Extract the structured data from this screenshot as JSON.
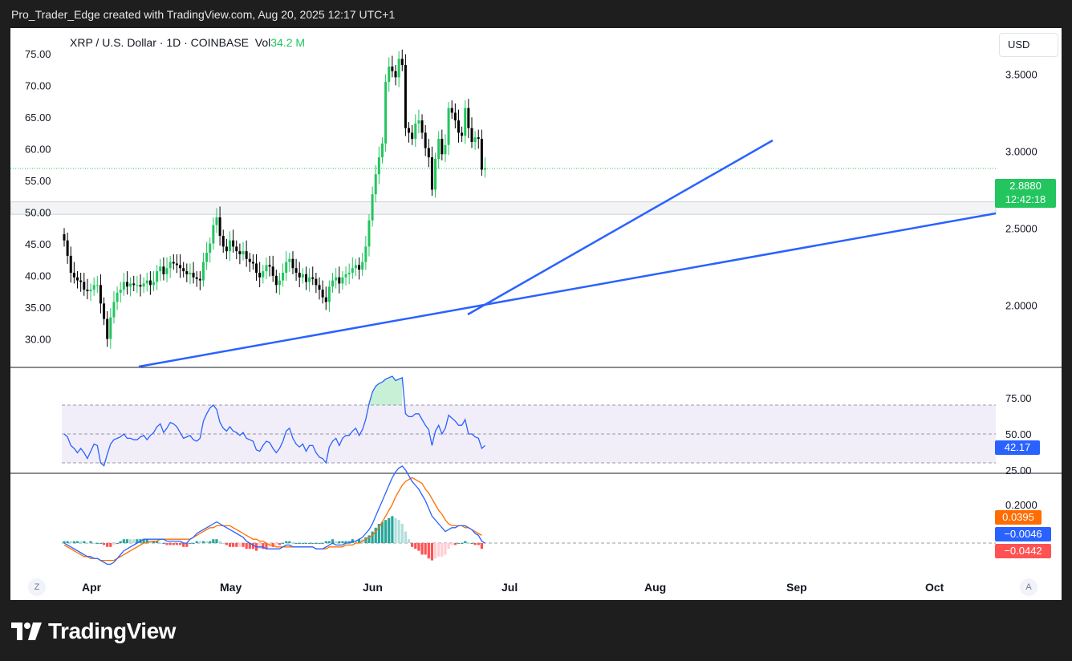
{
  "caption": "Pro_Trader_Edge created with TradingView.com, Aug 20, 2025 12:17 UTC+1",
  "legend": {
    "symbol": "XRP / U.S. Dollar · 1D · COINBASE",
    "vol_label": "Vol",
    "vol_value": "34.2 M"
  },
  "currency_label": "USD",
  "brand": "TradingView",
  "buttons": {
    "zoom": "Z",
    "auto": "A"
  },
  "colors": {
    "up": "#22c55e",
    "down": "#000000",
    "trendline": "#2962ff",
    "macd": "#2962ff",
    "signal": "#ff6d00",
    "rsi": "#2962ff",
    "rsi_band": "#7e57c2"
  },
  "price_tag": {
    "price": "2.8880",
    "countdown": "12:42:18"
  },
  "rsi_tag": "42.17",
  "macd_tags": {
    "signal": "0.0395",
    "macd": "−0.0046",
    "histogram": "−0.0442"
  },
  "chart_data": [
    {
      "type": "candlestick",
      "title": "XRP / U.S. Dollar · 1D · COINBASE",
      "x_ticks": [
        "Apr",
        "May",
        "Jun",
        "Jul",
        "Aug",
        "Sep",
        "Oct"
      ],
      "left_axis_ticks": [
        "75.00",
        "70.00",
        "65.00",
        "60.00",
        "55.00",
        "50.00",
        "45.00",
        "40.00",
        "35.00",
        "30.00"
      ],
      "right_axis_ticks": [
        "3.5000",
        "3.0000",
        "2.5000",
        "2.0000"
      ],
      "ylim": [
        1.6,
        3.8
      ],
      "last_price": 2.888,
      "close": [
        2.42,
        2.32,
        2.21,
        2.18,
        2.16,
        2.15,
        2.1,
        2.09,
        2.1,
        2.13,
        2.13,
        2.01,
        1.91,
        1.78,
        1.92,
        2.02,
        2.08,
        2.1,
        2.15,
        2.12,
        2.14,
        2.13,
        2.13,
        2.12,
        2.14,
        2.16,
        2.13,
        2.15,
        2.22,
        2.25,
        2.2,
        2.24,
        2.28,
        2.27,
        2.26,
        2.24,
        2.22,
        2.2,
        2.21,
        2.18,
        2.17,
        2.16,
        2.28,
        2.34,
        2.4,
        2.52,
        2.57,
        2.45,
        2.38,
        2.35,
        2.42,
        2.38,
        2.35,
        2.33,
        2.35,
        2.3,
        2.28,
        2.27,
        2.21,
        2.18,
        2.22,
        2.26,
        2.25,
        2.19,
        2.13,
        2.16,
        2.21,
        2.28,
        2.3,
        2.24,
        2.21,
        2.18,
        2.2,
        2.15,
        2.18,
        2.17,
        2.13,
        2.1,
        2.05,
        2.02,
        2.12,
        2.16,
        2.18,
        2.14,
        2.18,
        2.2,
        2.21,
        2.24,
        2.26,
        2.23,
        2.28,
        2.38,
        2.55,
        2.72,
        2.85,
        2.96,
        3.05,
        3.45,
        3.55,
        3.52,
        3.48,
        3.6,
        3.56,
        3.15,
        3.12,
        3.08,
        3.18,
        3.2,
        3.12,
        3.02,
        2.96,
        2.75,
        2.95,
        3.08,
        2.98,
        3.04,
        3.28,
        3.25,
        3.2,
        3.12,
        3.1,
        3.28,
        3.15,
        3.06,
        3.09,
        3.08,
        2.88,
        2.89
      ],
      "rsi": {
        "levels": [
          70,
          50,
          30
        ],
        "ticks": [
          "75.00",
          "50.00",
          "25.00"
        ],
        "last": 42.17,
        "values": [
          50,
          48,
          42,
          40,
          37,
          40,
          37,
          33,
          38,
          43,
          42,
          30,
          28,
          36,
          43,
          46,
          47,
          48,
          50,
          47,
          47,
          46,
          46,
          48,
          49,
          46,
          49,
          51,
          55,
          57,
          51,
          54,
          58,
          57,
          55,
          51,
          47,
          48,
          49,
          46,
          45,
          47,
          59,
          64,
          68,
          70,
          67,
          58,
          54,
          52,
          55,
          52,
          51,
          49,
          51,
          47,
          46,
          45,
          39,
          38,
          42,
          45,
          44,
          40,
          37,
          40,
          45,
          52,
          54,
          47,
          43,
          41,
          43,
          38,
          42,
          42,
          37,
          34,
          33,
          30,
          41,
          45,
          47,
          42,
          47,
          49,
          49,
          52,
          54,
          49,
          53,
          60,
          71,
          79,
          83,
          85,
          86,
          88,
          89,
          90,
          87,
          88,
          89,
          64,
          62,
          62,
          64,
          64,
          60,
          56,
          53,
          42,
          52,
          56,
          50,
          54,
          63,
          61,
          59,
          56,
          56,
          60,
          50,
          50,
          48,
          47,
          40,
          42
        ]
      },
      "macd": {
        "ticks": [
          "0.2000"
        ],
        "last": {
          "signal": 0.0395,
          "macd": -0.0046,
          "histogram": -0.0442
        },
        "macd_values": [
          0.0,
          -0.01,
          -0.02,
          -0.03,
          -0.04,
          -0.05,
          -0.06,
          -0.07,
          -0.07,
          -0.08,
          -0.08,
          -0.09,
          -0.1,
          -0.11,
          -0.11,
          -0.1,
          -0.08,
          -0.06,
          -0.04,
          -0.03,
          -0.02,
          -0.01,
          0.0,
          0.01,
          0.02,
          0.02,
          0.02,
          0.02,
          0.02,
          0.02,
          0.02,
          0.01,
          0.01,
          0.01,
          0.01,
          0.01,
          0.0,
          0.0,
          0.02,
          0.03,
          0.05,
          0.06,
          0.07,
          0.08,
          0.09,
          0.1,
          0.11,
          0.1,
          0.09,
          0.08,
          0.07,
          0.06,
          0.05,
          0.04,
          0.03,
          0.01,
          0.0,
          -0.01,
          -0.02,
          -0.02,
          -0.02,
          -0.03,
          -0.03,
          -0.03,
          -0.03,
          -0.03,
          -0.02,
          -0.01,
          -0.01,
          -0.02,
          -0.02,
          -0.02,
          -0.02,
          -0.02,
          -0.02,
          -0.02,
          -0.03,
          -0.03,
          -0.03,
          -0.02,
          -0.01,
          0.0,
          -0.01,
          -0.01,
          -0.01,
          0.0,
          0.0,
          0.01,
          0.01,
          0.02,
          0.03,
          0.05,
          0.07,
          0.1,
          0.14,
          0.18,
          0.22,
          0.26,
          0.3,
          0.34,
          0.37,
          0.39,
          0.4,
          0.38,
          0.35,
          0.32,
          0.3,
          0.28,
          0.25,
          0.22,
          0.18,
          0.14,
          0.12,
          0.1,
          0.08,
          0.06,
          0.07,
          0.08,
          0.08,
          0.09,
          0.09,
          0.09,
          0.08,
          0.07,
          0.05,
          0.04,
          0.01,
          -0.0
        ],
        "signal_values": [
          -0.01,
          -0.02,
          -0.03,
          -0.04,
          -0.05,
          -0.06,
          -0.07,
          -0.07,
          -0.08,
          -0.08,
          -0.08,
          -0.09,
          -0.09,
          -0.09,
          -0.09,
          -0.09,
          -0.08,
          -0.07,
          -0.06,
          -0.05,
          -0.04,
          -0.03,
          -0.02,
          -0.01,
          0.0,
          0.0,
          0.01,
          0.01,
          0.01,
          0.02,
          0.02,
          0.02,
          0.02,
          0.02,
          0.02,
          0.02,
          0.02,
          0.02,
          0.02,
          0.03,
          0.04,
          0.05,
          0.06,
          0.07,
          0.08,
          0.08,
          0.09,
          0.09,
          0.09,
          0.09,
          0.09,
          0.08,
          0.07,
          0.06,
          0.05,
          0.04,
          0.03,
          0.02,
          0.02,
          0.01,
          0.01,
          0.0,
          -0.01,
          -0.01,
          -0.02,
          -0.02,
          -0.02,
          -0.02,
          -0.02,
          -0.02,
          -0.02,
          -0.02,
          -0.02,
          -0.02,
          -0.02,
          -0.02,
          -0.03,
          -0.03,
          -0.03,
          -0.03,
          -0.02,
          -0.02,
          -0.02,
          -0.02,
          -0.02,
          -0.01,
          -0.01,
          -0.01,
          0.0,
          0.0,
          0.01,
          0.02,
          0.03,
          0.04,
          0.06,
          0.08,
          0.11,
          0.14,
          0.17,
          0.2,
          0.24,
          0.27,
          0.3,
          0.32,
          0.33,
          0.34,
          0.33,
          0.32,
          0.31,
          0.28,
          0.26,
          0.23,
          0.2,
          0.17,
          0.15,
          0.12,
          0.1,
          0.09,
          0.09,
          0.09,
          0.09,
          0.08,
          0.08,
          0.07,
          0.06,
          0.05,
          0.04
        ]
      }
    }
  ]
}
